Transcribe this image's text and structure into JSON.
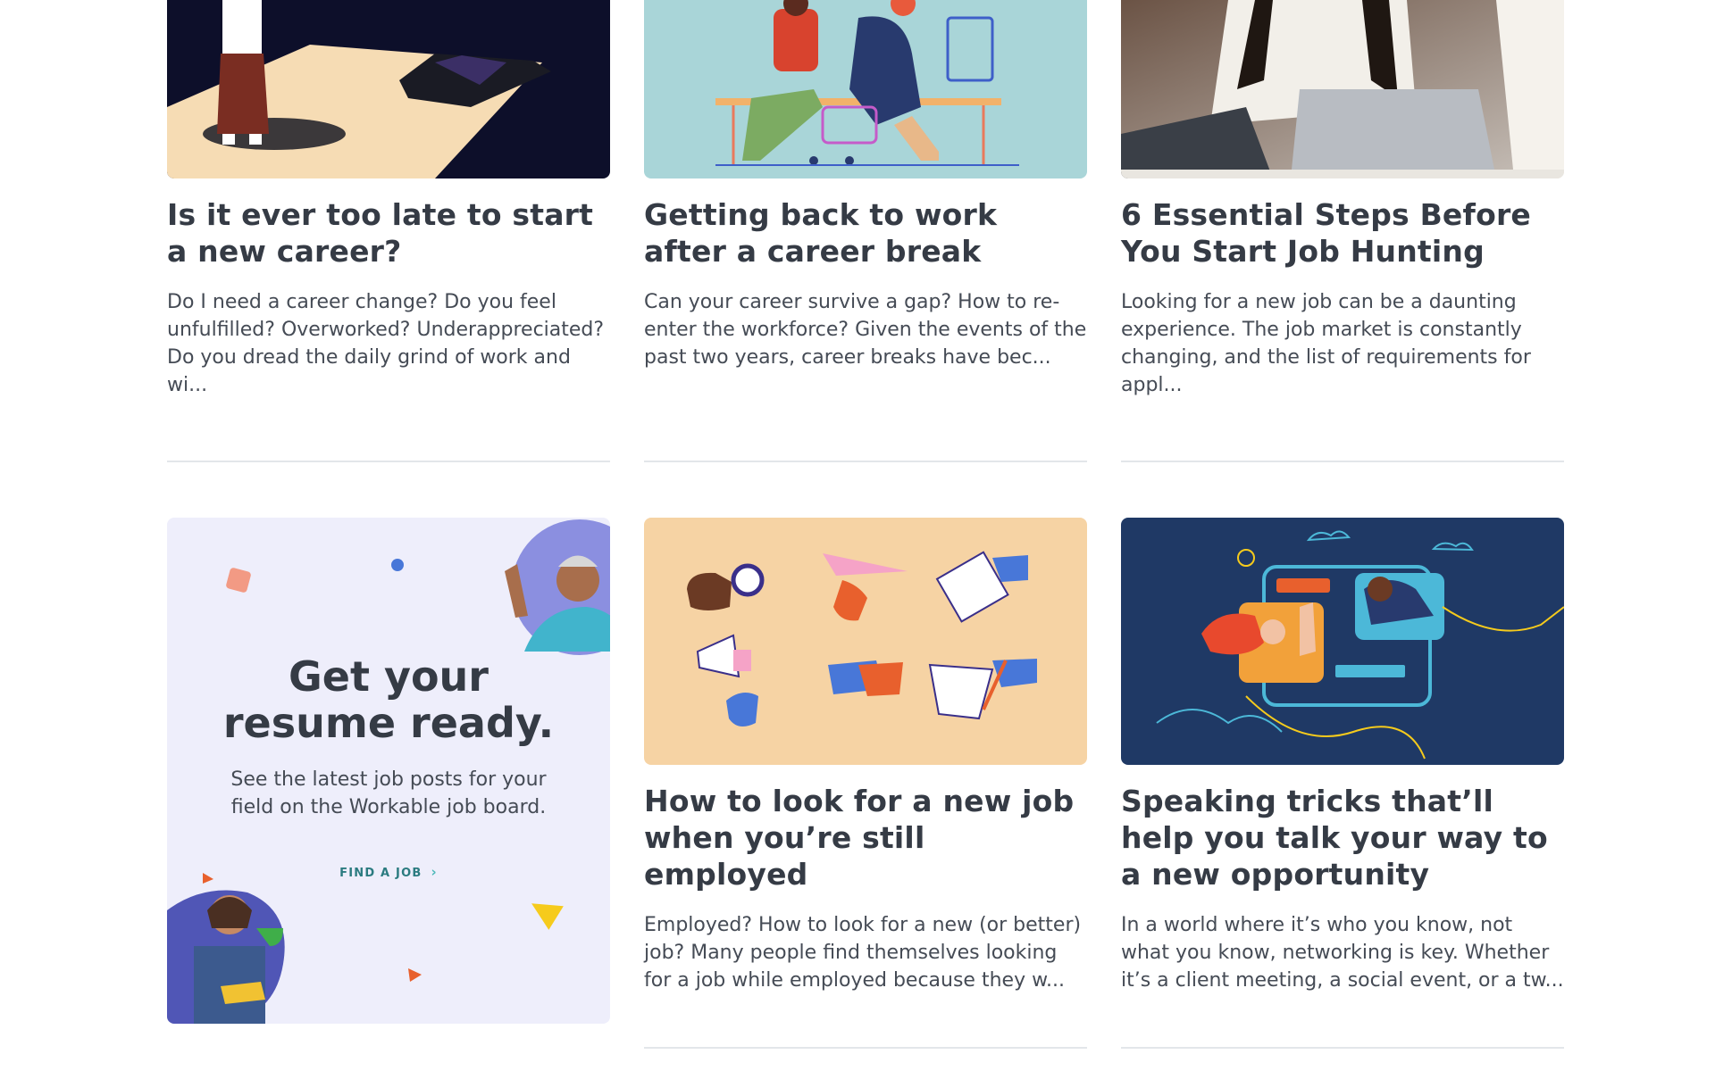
{
  "cards": [
    {
      "title": "Is it ever too late to start a new career?",
      "excerpt": "Do I need a career change? Do you feel unfulfilled? Overworked? Underappreciated? Do you dread the daily grind of work and wi..."
    },
    {
      "title": "Getting back to work after a career break",
      "excerpt": "Can your career survive a gap? How to re-enter the workforce? Given the events of the past two years, career breaks have bec..."
    },
    {
      "title": "6 Essential Steps Before You Start Job Hunting",
      "excerpt": "Looking for a new job can be a daunting experience. The job market is constantly changing, and the list of requirements for appl..."
    },
    {
      "title": "How to look for a new job when you’re still employed",
      "excerpt": "Employed? How to look for a new (or better) job? Many people find themselves looking for a job while employed because they w..."
    },
    {
      "title": "Speaking tricks that’ll help you talk your way to a new opportunity",
      "excerpt": "In a world where it’s who you know, not what you know, networking is key. Whether it’s a client meeting, a social event, or a tw..."
    }
  ],
  "promo": {
    "heading": "Get your resume ready.",
    "subtext": "See the latest job posts for your field on the Workable job board.",
    "cta_label": "FIND A JOB",
    "cta_icon": "chevron-right-icon"
  },
  "colors": {
    "promo_bg": "#eeeefb",
    "cta": "#2b7b80",
    "heading": "#353b45",
    "divider": "#e3e6ea"
  }
}
